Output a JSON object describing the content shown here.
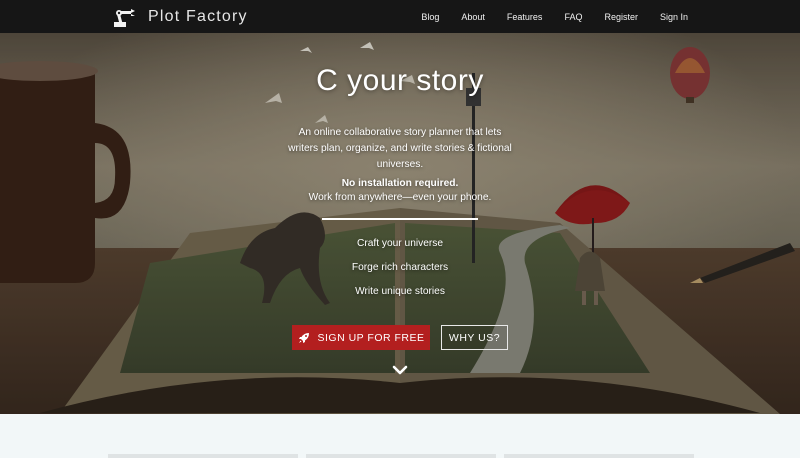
{
  "brand": {
    "name": "Plot Factory",
    "logo_icon": "robot-arm-logo"
  },
  "nav": {
    "links": [
      "Blog",
      "About",
      "Features",
      "FAQ",
      "Register",
      "Sign In"
    ]
  },
  "hero": {
    "headline": "C your story",
    "description": "An online collaborative story planner that lets writers plan, organize, and write stories & fictional universes.",
    "no_install": "No installation required.",
    "work_anywhere": "Work from anywhere—even your phone.",
    "features": [
      "Craft your universe",
      "Forge rich characters",
      "Write unique stories"
    ],
    "signup_button": "SIGN UP FOR FREE",
    "signup_icon": "rocket-icon",
    "why_button": "WHY US?",
    "scroll_icon": "chevron-down-icon"
  },
  "colors": {
    "navbar_bg": "#161616",
    "signup_red": "#b31f1f",
    "page_bg": "#f2f7f8"
  }
}
